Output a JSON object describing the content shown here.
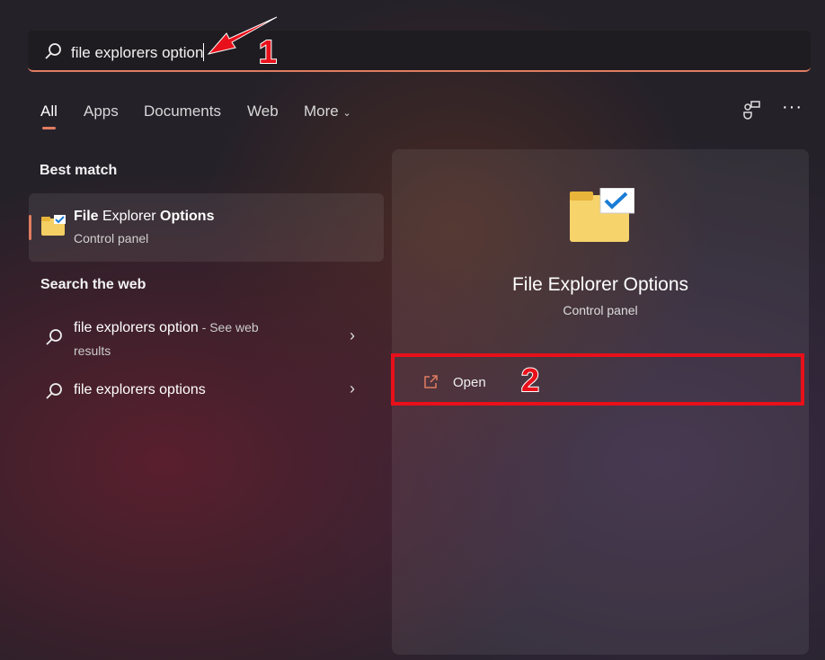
{
  "search": {
    "value": "file explorers option"
  },
  "tabs": [
    {
      "label": "All"
    },
    {
      "label": "Apps"
    },
    {
      "label": "Documents"
    },
    {
      "label": "Web"
    },
    {
      "label": "More"
    }
  ],
  "best_match": {
    "heading": "Best match",
    "title_part1": "File",
    "title_part2": " Explorer ",
    "title_part3": "Options",
    "subtitle": "Control panel"
  },
  "web": {
    "heading": "Search the web",
    "items": [
      {
        "label": "file explorers option",
        "suffix": " - See web",
        "suffix2": "results"
      },
      {
        "label": "file explorers options"
      }
    ]
  },
  "preview": {
    "title": "File Explorer Options",
    "subtitle": "Control panel",
    "open_label": "Open"
  },
  "annotations": {
    "step1": "1",
    "step2": "2"
  },
  "colors": {
    "accent": "#e07c62",
    "annotation": "#e8101a"
  }
}
